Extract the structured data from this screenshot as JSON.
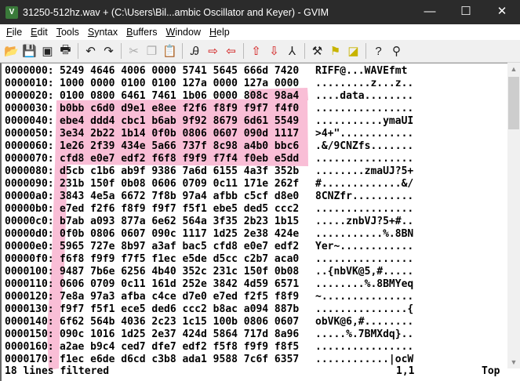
{
  "title": "31250-512hz.wav + (C:\\Users\\Bil...ambic Oscillator and Keyer) - GVIM",
  "window_controls": {
    "minimize": "—",
    "maximize": "☐",
    "close": "✕"
  },
  "menu": [
    {
      "u": "F",
      "rest": "ile"
    },
    {
      "u": "E",
      "rest": "dit"
    },
    {
      "u": "T",
      "rest": "ools"
    },
    {
      "u": "S",
      "rest": "yntax"
    },
    {
      "u": "B",
      "rest": "uffers"
    },
    {
      "u": "W",
      "rest": "indow"
    },
    {
      "u": "H",
      "rest": "elp"
    }
  ],
  "toolbar": [
    [
      "open-icon",
      "save-icon",
      "save-all-icon",
      "print-icon"
    ],
    [
      "undo-icon",
      "redo-icon"
    ],
    [
      "cut-icon",
      "copy-icon",
      "paste-icon"
    ],
    [
      "replace-icon",
      "find-next-icon",
      "find-prev-icon"
    ],
    [
      "load-session-icon",
      "save-session-icon",
      "run-script-icon"
    ],
    [
      "make-icon",
      "build-tags-icon",
      "jump-tag-icon"
    ],
    [
      "help-icon",
      "find-help-icon"
    ]
  ],
  "highlight_color": "#f7a8c8",
  "rows": [
    {
      "addr": "0000000:",
      "hex": "5249 4646 4006 0000 5741 5645 666d 7420",
      "ascii": "RIFF@...WAVEfmt "
    },
    {
      "addr": "0000010:",
      "hex": "1000 0000 0100 0100 127a 0000 127a 0000",
      "ascii": ".........z...z.."
    },
    {
      "addr": "0000020:",
      "hex": "0100 0800 6461 7461 1b06 0000 808c 98a4",
      "ascii": "....data........"
    },
    {
      "addr": "0000030:",
      "hex": "b0bb c6d0 d9e1 e8ee f2f6 f8f9 f9f7 f4f0",
      "ascii": "................"
    },
    {
      "addr": "0000040:",
      "hex": "ebe4 ddd4 cbc1 b6ab 9f92 8679 6d61 5549",
      "ascii": "...........ymaUI"
    },
    {
      "addr": "0000050:",
      "hex": "3e34 2b22 1b14 0f0b 0806 0607 090d 1117",
      "ascii": ">4+\"............"
    },
    {
      "addr": "0000060:",
      "hex": "1e26 2f39 434e 5a66 737f 8c98 a4b0 bbc6",
      "ascii": ".&/9CNZfs......."
    },
    {
      "addr": "0000070:",
      "hex": "cfd8 e0e7 edf2 f6f8 f9f9 f7f4 f0eb e5dd",
      "ascii": "................"
    },
    {
      "addr": "0000080:",
      "hex": "d5cb c1b6 ab9f 9386 7a6d 6155 4a3f 352b",
      "ascii": "........zmaUJ?5+"
    },
    {
      "addr": "0000090:",
      "hex": "231b 150f 0b08 0606 0709 0c11 171e 262f",
      "ascii": "#.............&/"
    },
    {
      "addr": "00000a0:",
      "hex": "3843 4e5a 6672 7f8b 97a4 afbb c5cf d8e0",
      "ascii": "8CNZfr.........."
    },
    {
      "addr": "00000b0:",
      "hex": "e7ed f2f6 f8f9 f9f7 f5f1 ebe5 ded5 ccc2",
      "ascii": "................"
    },
    {
      "addr": "00000c0:",
      "hex": "b7ab a093 877a 6e62 564a 3f35 2b23 1b15",
      "ascii": ".....znbVJ?5+#.."
    },
    {
      "addr": "00000d0:",
      "hex": "0f0b 0806 0607 090c 1117 1d25 2e38 424e",
      "ascii": "...........%.8BN"
    },
    {
      "addr": "00000e0:",
      "hex": "5965 727e 8b97 a3af bac5 cfd8 e0e7 edf2",
      "ascii": "Yer~............"
    },
    {
      "addr": "00000f0:",
      "hex": "f6f8 f9f9 f7f5 f1ec e5de d5cc c2b7 aca0",
      "ascii": "................"
    },
    {
      "addr": "0000100:",
      "hex": "9487 7b6e 6256 4b40 352c 231c 150f 0b08",
      "ascii": "..{nbVK@5,#....."
    },
    {
      "addr": "0000110:",
      "hex": "0606 0709 0c11 161d 252e 3842 4d59 6571",
      "ascii": "........%.8BMYeq"
    },
    {
      "addr": "0000120:",
      "hex": "7e8a 97a3 afba c4ce d7e0 e7ed f2f5 f8f9",
      "ascii": "~..............."
    },
    {
      "addr": "0000130:",
      "hex": "f9f7 f5f1 ece5 ded6 ccc2 b8ac a094 887b",
      "ascii": "...............{"
    },
    {
      "addr": "0000140:",
      "hex": "6f62 564b 4036 2c23 1c15 100b 0806 0607",
      "ascii": "obVK@6,#........"
    },
    {
      "addr": "0000150:",
      "hex": "090c 1016 1d25 2e37 424d 5864 717d 8a96",
      "ascii": ".....%.7BMXdq}.."
    },
    {
      "addr": "0000160:",
      "hex": "a2ae b9c4 ced7 dfe7 edf2 f5f8 f9f9 f8f5",
      "ascii": "................"
    },
    {
      "addr": "0000170:",
      "hex": "f1ec e6de d6cd c3b8 ada1 9588 7c6f 6357",
      "ascii": "............|ocW"
    }
  ],
  "status": {
    "message": "18 lines filtered",
    "position": "1,1",
    "scroll": "Top"
  }
}
